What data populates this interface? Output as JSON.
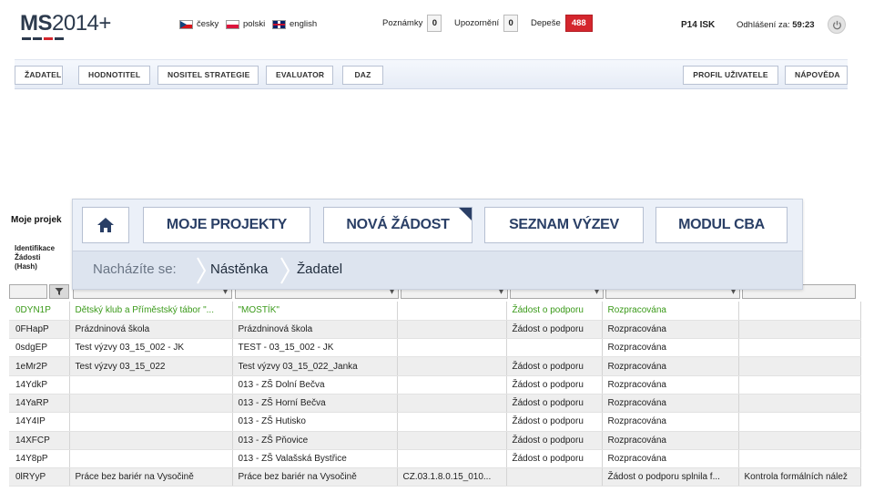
{
  "header": {
    "logo_prefix": "MS",
    "logo_suffix": "2014+",
    "languages": [
      {
        "label": "česky",
        "flag": "cz-flag-icon"
      },
      {
        "label": "polski",
        "flag": "pl-flag-icon"
      },
      {
        "label": "english",
        "flag": "en-flag-icon"
      }
    ],
    "counters": [
      {
        "label": "Poznámky",
        "value": "0"
      },
      {
        "label": "Upozornění",
        "value": "0"
      },
      {
        "label": "Depeše",
        "value": "488"
      }
    ],
    "user": "P14 ISK",
    "logout_label": "Odhlášení za:",
    "logout_time": "59:23",
    "power_icon": "power-icon"
  },
  "roles": {
    "left": [
      "ŽADATEL",
      "HODNOTITEL",
      "NOSITEL STRATEGIE",
      "EVALUATOR",
      "DAZ"
    ],
    "right": [
      "PROFIL UŽIVATELE",
      "NÁPOVĚDA"
    ]
  },
  "panel": {
    "title": "Moje projek",
    "column_header": [
      "Identifikace",
      "Žádosti",
      "(Hash)"
    ]
  },
  "nav": {
    "home_icon": "home-icon",
    "buttons": [
      "MOJE PROJEKTY",
      "NOVÁ ŽÁDOST",
      "SEZNAM VÝZEV",
      "MODUL CBA"
    ],
    "breadcrumb_label": "Nacházíte se:",
    "breadcrumbs": [
      "Nástěnka",
      "Žadatel"
    ]
  },
  "table": {
    "rows": [
      [
        "0DYN1P",
        "Dětský klub a Příměstský tábor \"...",
        "\"MOSTÍK\"",
        "",
        "Žádost o podporu",
        "Rozpracována",
        ""
      ],
      [
        "0FHapP",
        "Prázdninová škola",
        "Prázdninová škola",
        "",
        "Žádost o podporu",
        "Rozpracována",
        ""
      ],
      [
        "0sdgEP",
        "Test výzvy 03_15_002 - JK",
        "TEST - 03_15_002 - JK",
        "",
        "",
        "Rozpracována",
        ""
      ],
      [
        "1eMr2P",
        "Test výzvy 03_15_022",
        "Test výzvy 03_15_022_Janka",
        "",
        "Žádost o podporu",
        "Rozpracována",
        ""
      ],
      [
        "14YdkP",
        "",
        "013 - ZŠ Dolní Bečva",
        "",
        "Žádost o podporu",
        "Rozpracována",
        ""
      ],
      [
        "14YaRP",
        "",
        "013 - ZŠ Horní Bečva",
        "",
        "Žádost o podporu",
        "Rozpracována",
        ""
      ],
      [
        "14Y4IP",
        "",
        "013 - ZŠ Hutisko",
        "",
        "Žádost o podporu",
        "Rozpracována",
        ""
      ],
      [
        "14XFCP",
        "",
        "013 - ZŠ Pňovice",
        "",
        "Žádost o podporu",
        "Rozpracována",
        ""
      ],
      [
        "14Y8pP",
        "",
        "013 - ZŠ Valašská Bystřice",
        "",
        "Žádost o podporu",
        "Rozpracována",
        ""
      ],
      [
        "0lRYyP",
        "Práce bez bariér na Vysočině",
        "Práce bez bariér na Vysočině",
        "CZ.03.1.8.0.15_010...",
        "",
        "Žádost o podporu splnila f...",
        "Kontrola formálních nálež"
      ]
    ]
  },
  "colors": {
    "brand_dark": "#2c3a4d",
    "brand_red": "#d4262d",
    "nav_text": "#2a3f66",
    "selected_row_text": "#3a9a19"
  }
}
